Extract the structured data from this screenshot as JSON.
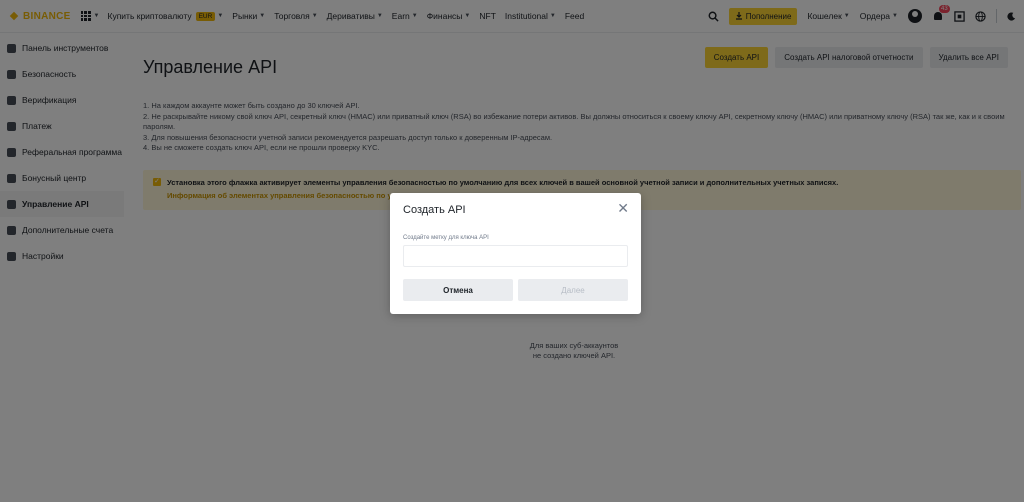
{
  "topnav": {
    "logo": "BINANCE",
    "items": [
      {
        "label": "Купить криптовалюту",
        "badge": "EUR",
        "caret": true
      },
      {
        "label": "Рынки",
        "caret": true
      },
      {
        "label": "Торговля",
        "caret": true
      },
      {
        "label": "Деривативы",
        "caret": true
      },
      {
        "label": "Earn",
        "caret": true
      },
      {
        "label": "Финансы",
        "caret": true
      },
      {
        "label": "NFT",
        "caret": false
      },
      {
        "label": "Institutional",
        "caret": true
      },
      {
        "label": "Feed",
        "caret": false
      }
    ],
    "deposit_label": "Пополнение",
    "wallet_label": "Кошелек",
    "orders_label": "Ордера",
    "notification_count": "43",
    "icons": [
      "search-icon",
      "user-icon",
      "bell-icon",
      "download-icon",
      "globe-icon",
      "moon-icon"
    ]
  },
  "sidebar": {
    "items": [
      {
        "label": "Панель инструментов",
        "icon": "user-icon",
        "active": false
      },
      {
        "label": "Безопасность",
        "icon": "shield-icon",
        "active": false
      },
      {
        "label": "Верификация",
        "icon": "id-card-icon",
        "active": false
      },
      {
        "label": "Платеж",
        "icon": "payment-icon",
        "active": false
      },
      {
        "label": "Реферальная программа",
        "icon": "referral-icon",
        "active": false
      },
      {
        "label": "Бонусный центр",
        "icon": "gift-icon",
        "active": false
      },
      {
        "label": "Управление API",
        "icon": "api-icon",
        "active": true
      },
      {
        "label": "Дополнительные счета",
        "icon": "sub-accounts-icon",
        "active": false
      },
      {
        "label": "Настройки",
        "icon": "settings-icon",
        "active": false
      }
    ]
  },
  "main": {
    "title": "Управление API",
    "create_api_label": "Создать API",
    "create_tax_api_label": "Создать API налоговой отчетности",
    "delete_all_label": "Удалить все API",
    "notes": [
      "1. На каждом аккаунте может быть создано до 30 ключей API.",
      "2. Не раскрывайте никому свой ключ API, секретный ключ (HMAC) или приватный ключ (RSA) во избежание потери активов. Вы должны относиться к своему ключу API, секретному ключу (HMAC) или приватному ключу (RSA) так же, как и к своим паролям.",
      "3. Для повышения безопасности учетной записи рекомендуется разрешать доступ только к доверенным IP-адресам.",
      "4. Вы не сможете создать ключ API, если не прошли проверку KYC."
    ],
    "warning_text": "Установка этого флажка активирует элементы управления безопасностью по умолчанию для всех ключей в вашей основной учетной записи и дополнительных учетных записях.",
    "warning_link": "Информация об элементах управления безопасностью по умо",
    "empty_line1": "Для ваших суб-аккаунтов",
    "empty_line2": "не создано ключей API."
  },
  "modal": {
    "title": "Создать API",
    "field_label": "Создайте метку для ключа API",
    "field_value": "",
    "cancel_label": "Отмена",
    "next_label": "Далее"
  },
  "colors": {
    "accent": "#fcd535",
    "brand": "#f0b90b",
    "warning_bg": "#fef6d8",
    "link": "#c99400"
  }
}
